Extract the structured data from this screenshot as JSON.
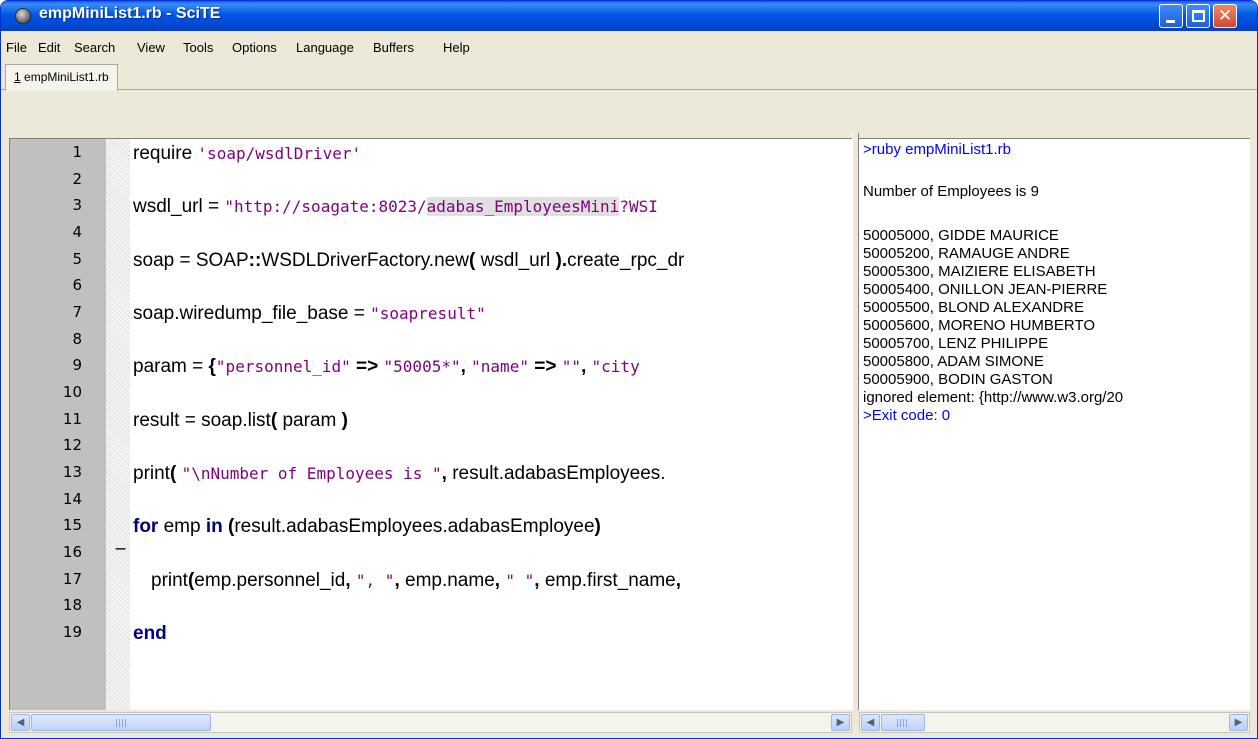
{
  "window": {
    "title": "empMiniList1.rb - SciTE"
  },
  "titlebar": {
    "close_glyph": "✕",
    "accent_color": "#0058e6",
    "close_color": "#d5472a"
  },
  "menu": {
    "items": [
      "File",
      "Edit",
      "Search",
      "View",
      "Tools",
      "Options",
      "Language",
      "Buffers",
      "Help"
    ]
  },
  "tab": {
    "number": "1",
    "label": " empMiniList1.rb"
  },
  "editor": {
    "line_numbers": [
      "1",
      "2",
      "3",
      "4",
      "5",
      "6",
      "7",
      "8",
      "9",
      "10",
      "11",
      "12",
      "13",
      "14",
      "15",
      "16",
      "17",
      "18",
      "19"
    ],
    "fold_marker": "−",
    "lines": {
      "l1": {
        "a": "require ",
        "b": "'soap/wsdlDriver'"
      },
      "l3": {
        "a": "wsdl_url = ",
        "b": "\"http://soagate:8023/",
        "c": "adabas_EmployeesMini",
        "d": "?WSI"
      },
      "l5": {
        "a": "soap = SOAP",
        "b": "::",
        "c": "WSDLDriverFactory.new",
        "d": "( ",
        "e": "wsdl_url ",
        "f": ").",
        "g": "create_rpc_dr"
      },
      "l7": {
        "a": "soap.wiredump_file_base = ",
        "b": "\"soapresult\""
      },
      "l9": {
        "a": "param = ",
        "b": "{",
        "c": "\"personnel_id\"",
        "d": " => ",
        "e": "\"50005*\"",
        "f": ", ",
        "g": "\"name\"",
        "h": " => ",
        "i": "\"\"",
        "j": ", ",
        "k": "\"city"
      },
      "l11": {
        "a": "result = soap.list",
        "b": "( ",
        "c": "param ",
        "d": ")"
      },
      "l13": {
        "a": "print",
        "b": "( ",
        "c": "\"\\nNumber of Employees is \"",
        "d": ", ",
        "e": "result.adabasEmployees."
      },
      "l15": {
        "a": "for",
        "b": " emp ",
        "c": "in",
        "d": " ",
        "e": "(",
        "f": "result.adabasEmployees.adabasEmployee",
        "g": ")"
      },
      "l17": {
        "a": "print",
        "b": "(",
        "c": "emp.personnel_id",
        "d": ", ",
        "e": "\", \"",
        "f": ", ",
        "g": "emp.name",
        "h": ", ",
        "i": "\" \"",
        "j": ", ",
        "k": "emp.first_name",
        "l": ","
      },
      "l19": {
        "a": "end"
      }
    },
    "string_color": "#7f007f",
    "keyword_color": "#00007f"
  },
  "output": {
    "lines": [
      ">ruby empMiniList1.rb",
      "Number of Employees is 9",
      "50005000, GIDDE MAURICE",
      "50005200, RAMAUGE ANDRE",
      "50005300, MAIZIERE ELISABETH",
      "50005400, ONILLON JEAN-PIERRE",
      "50005500, BLOND ALEXANDRE",
      "50005600, MORENO HUMBERTO",
      "50005700, LENZ PHILIPPE",
      "50005800, ADAM SIMONE",
      "50005900, BODIN GASTON",
      "ignored element: {http://www.w3.org/20",
      ">Exit code: 0"
    ],
    "command_color": "#0000ff"
  },
  "scrollbars": {
    "left_arrow": "◀",
    "right_arrow": "▶"
  }
}
